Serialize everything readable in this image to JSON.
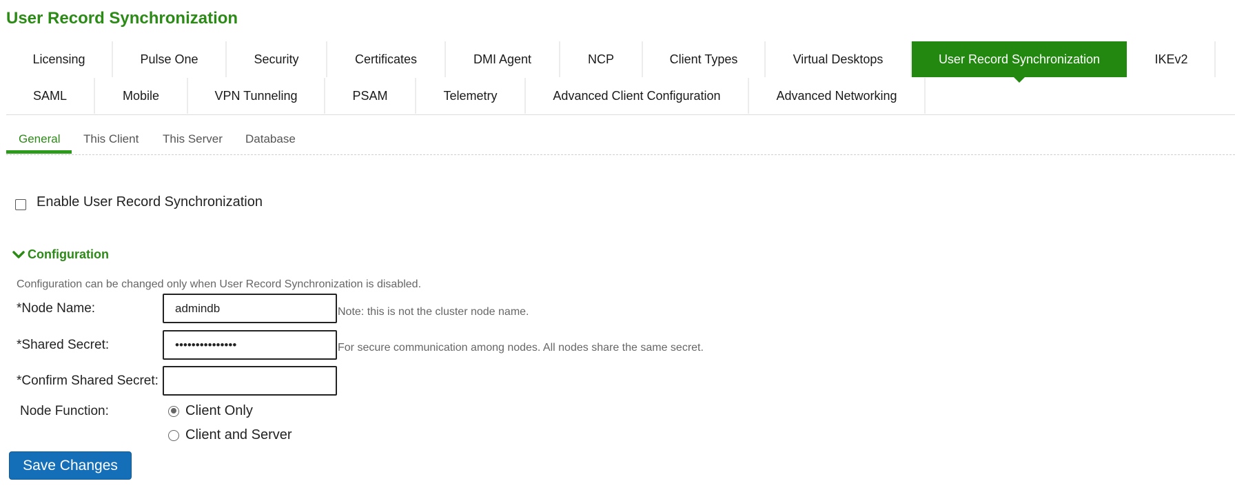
{
  "page": {
    "title": "User Record Synchronization"
  },
  "tabs": {
    "row1": [
      {
        "label": "Licensing",
        "active": false
      },
      {
        "label": "Pulse One",
        "active": false
      },
      {
        "label": "Security",
        "active": false
      },
      {
        "label": "Certificates",
        "active": false
      },
      {
        "label": "DMI Agent",
        "active": false
      },
      {
        "label": "NCP",
        "active": false
      },
      {
        "label": "Client Types",
        "active": false
      },
      {
        "label": "Virtual Desktops",
        "active": false
      },
      {
        "label": "User Record Synchronization",
        "active": true
      },
      {
        "label": "IKEv2",
        "active": false
      }
    ],
    "row2": [
      {
        "label": "SAML",
        "active": false
      },
      {
        "label": "Mobile",
        "active": false
      },
      {
        "label": "VPN Tunneling",
        "active": false
      },
      {
        "label": "PSAM",
        "active": false
      },
      {
        "label": "Telemetry",
        "active": false
      },
      {
        "label": "Advanced Client Configuration",
        "active": false
      },
      {
        "label": "Advanced Networking",
        "active": false
      }
    ]
  },
  "subtabs": [
    {
      "label": "General",
      "active": true
    },
    {
      "label": "This Client",
      "active": false
    },
    {
      "label": "This Server",
      "active": false
    },
    {
      "label": "Database",
      "active": false
    }
  ],
  "enable": {
    "label": "Enable User Record Synchronization",
    "checked": false
  },
  "configuration": {
    "title": "Configuration",
    "expanded": true,
    "note": "Configuration can be changed only when User Record Synchronization is disabled.",
    "node_name": {
      "label": "*Node Name:",
      "value": "admindb",
      "hint": "Note: this is not the cluster node name."
    },
    "shared_secret": {
      "label": "*Shared Secret:",
      "value": "•••••••••••••••",
      "hint": "For secure communication among nodes. All nodes share the same secret."
    },
    "confirm_secret": {
      "label": "*Confirm Shared Secret:",
      "value": ""
    },
    "node_function": {
      "label": "Node Function:",
      "options": [
        {
          "label": "Client Only",
          "selected": true
        },
        {
          "label": "Client and Server",
          "selected": false
        }
      ]
    }
  },
  "actions": {
    "save_label": "Save Changes"
  },
  "colors": {
    "brand_green": "#2c8a17",
    "active_tab_bg": "#22880f",
    "save_button_bg": "#146fb8"
  },
  "icons": {
    "section_toggle": "chevron-down-icon"
  }
}
